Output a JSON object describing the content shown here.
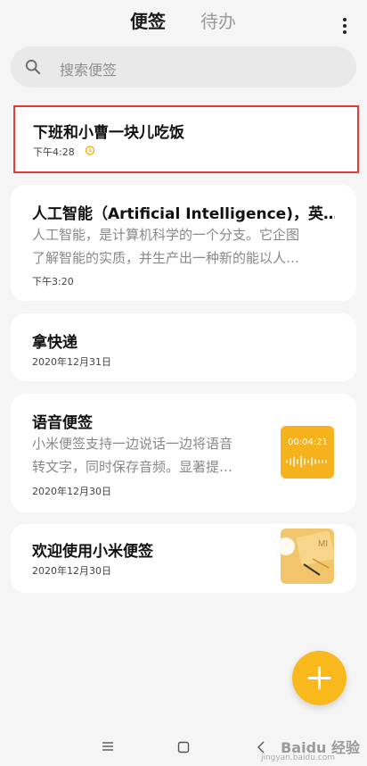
{
  "header": {
    "tabs": [
      {
        "label": "便签",
        "active": true
      },
      {
        "label": "待办",
        "active": false
      }
    ],
    "more_icon": "more-vertical-icon"
  },
  "search": {
    "placeholder": "搜索便签",
    "icon": "search-icon"
  },
  "notes": [
    {
      "title": "下班和小曹一块儿吃饭",
      "date": "下午4:28",
      "has_alarm": true
    },
    {
      "title": "人工智能（Artificial Intelligence)，英…",
      "body": [
        "人工智能，是计算机科学的一个分支。它企图",
        "了解智能的实质，并生产出一种新的能以人…"
      ],
      "date": "下午3:20"
    },
    {
      "title": "拿快递",
      "date": "2020年12月31日"
    },
    {
      "title": "语音便签",
      "body": [
        "小米便签支持一边说话一边将语音",
        "转文字，同时保存音频。显著提…"
      ],
      "date": "2020年12月30日",
      "thumbnail": {
        "type": "audio",
        "duration": "00:04:21"
      }
    },
    {
      "title": "欢迎使用小米便签",
      "date": "2020年12月30日",
      "thumbnail": {
        "type": "image",
        "label": "MI"
      }
    }
  ],
  "fab": {
    "icon": "plus-icon"
  },
  "nav": {
    "icons": [
      "menu-icon",
      "home-square-icon",
      "back-icon"
    ]
  },
  "watermark": {
    "text": "Baidu 经验",
    "sub": "jingyan.baidu.com"
  },
  "colors": {
    "accent": "#f9b81b",
    "highlight_border": "#e53935"
  }
}
